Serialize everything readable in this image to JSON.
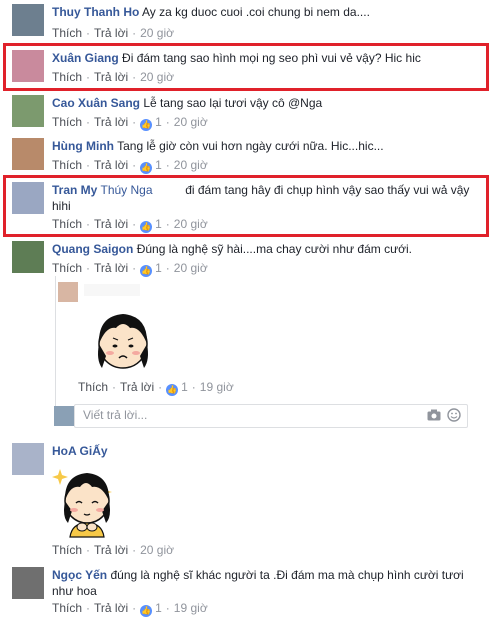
{
  "actions": {
    "like": "Thích",
    "reply": "Trả lời",
    "dot": "·"
  },
  "comments": [
    {
      "name": "Thuy Thanh Ho",
      "text": "Ay za kg duoc cuoi .coi chung bi nem da....",
      "time": "20 giờ"
    },
    {
      "name": "Xuân Giang",
      "text": "Đi đám tang sao hình mọi ng seo phì vui vẻ vậy? Hic hic",
      "time": "20 giờ"
    },
    {
      "name": "Cao Xuân Sang",
      "text": "Lễ tang sao lại tươi vậy cô @Nga",
      "likes": "1",
      "time": "20 giờ"
    },
    {
      "name": "Hùng Minh",
      "text": "Tang lễ giờ còn vui hơn ngày cưới nữa. Hic...hic...",
      "likes": "1",
      "time": "20 giờ"
    },
    {
      "name": "Tran My",
      "mention": "Thúy Nga",
      "text_line1": "đi đám tang hây đi chụp hình vậy sao thấy vui wả vậy",
      "text_line2": "hihi",
      "likes": "1",
      "time": "20 giờ"
    },
    {
      "name": "Quang Saigon",
      "text": "Đúng là nghệ sỹ hài....ma chay cười như đám cưới.",
      "likes": "1",
      "time": "20 giờ"
    },
    {
      "name": "HoA GiẤy",
      "text": "",
      "time": "20 giờ"
    },
    {
      "name": "Ngọc Yến",
      "text_line1": "đúng là nghệ sĩ khác người ta .Đi đám ma mà chụp hình cười tươi",
      "text_line2": "như hoa",
      "likes": "1",
      "time": "19 giờ"
    }
  ],
  "reply": {
    "likes": "1",
    "time": "19 giờ"
  },
  "reply_input": {
    "placeholder": "Viết trả lời..."
  },
  "colors": {
    "name": "#365899",
    "highlight_box": "#e0212a",
    "like_badge": "#5890ff"
  }
}
